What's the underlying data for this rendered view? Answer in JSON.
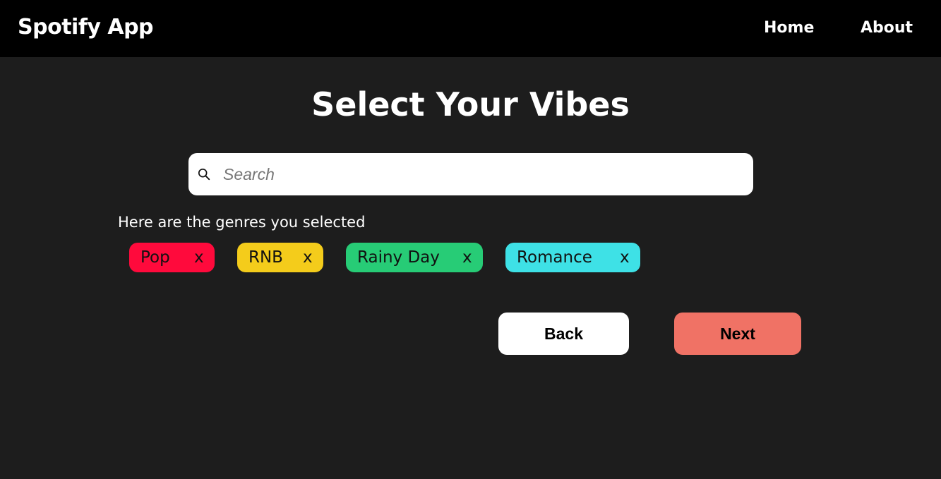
{
  "navbar": {
    "brand": "Spotify App",
    "links": [
      {
        "label": "Home"
      },
      {
        "label": "About"
      }
    ]
  },
  "main": {
    "title": "Select Your Vibes",
    "search": {
      "placeholder": "Search",
      "value": "",
      "icon": "search-icon"
    },
    "selected_label": "Here are the genres you selected",
    "chips": [
      {
        "label": "Pop",
        "remove": "x",
        "color": "#ff0a3c"
      },
      {
        "label": "RNB",
        "remove": "x",
        "color": "#f4cc1b"
      },
      {
        "label": "Rainy Day",
        "remove": "x",
        "color": "#27cc76"
      },
      {
        "label": "Romance",
        "remove": "x",
        "color": "#3ee1e6"
      }
    ],
    "buttons": {
      "back": {
        "label": "Back",
        "color": "#ffffff"
      },
      "next": {
        "label": "Next",
        "color": "#f07265"
      }
    }
  }
}
